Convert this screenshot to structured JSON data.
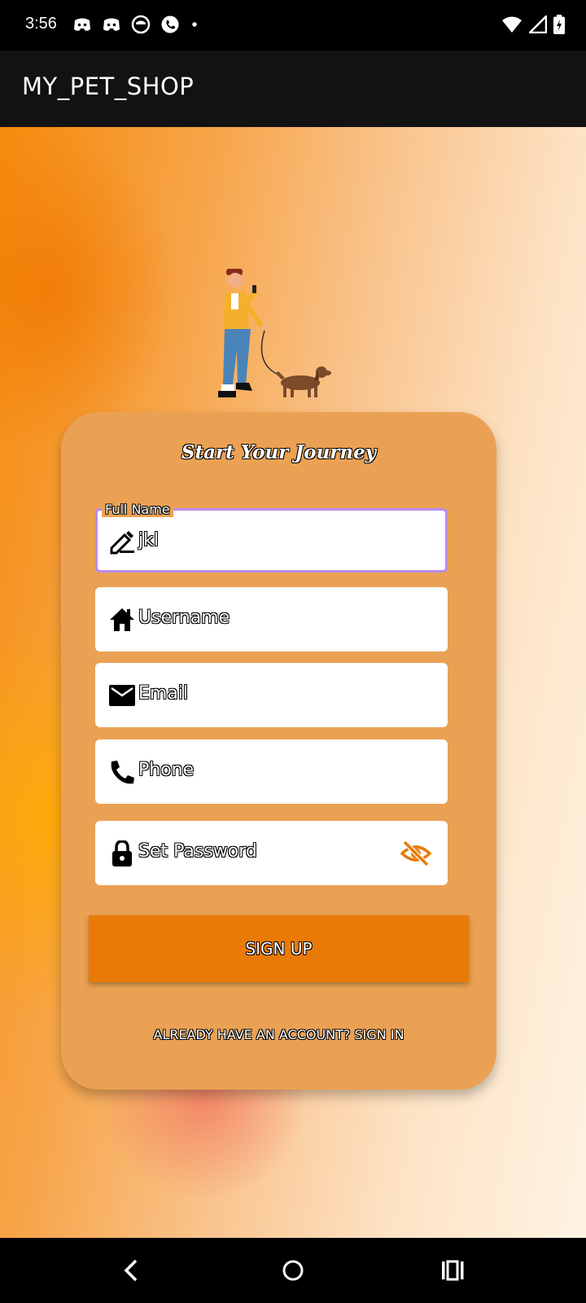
{
  "status_bar": {
    "time": "3:56",
    "notification_icons": [
      "discord-icon",
      "discord-icon",
      "messenger-icon",
      "viber-icon",
      "dot-icon"
    ],
    "system_icons": [
      "wifi-icon",
      "signal-icon",
      "battery-charging-icon"
    ]
  },
  "app_bar": {
    "title": "MY_PET_SHOP"
  },
  "illustration": {
    "icon": "man-walking-dog-illustration"
  },
  "form": {
    "title": "Start Your Journey",
    "full_name": {
      "label": "Full Name",
      "value": "jkl",
      "icon": "pencil-icon"
    },
    "username": {
      "placeholder": "Username",
      "icon": "home-icon"
    },
    "email": {
      "placeholder": "Email",
      "icon": "email-icon"
    },
    "phone": {
      "placeholder": "Phone",
      "icon": "phone-icon"
    },
    "password": {
      "placeholder": "Set Password",
      "icon": "lock-icon",
      "toggle_icon": "eye-off-icon"
    },
    "signup_label": "SIGN UP",
    "signin_link": "ALREADY HAVE AN ACCOUNT? SIGN IN"
  },
  "colors": {
    "card": "#eba153",
    "button": "#ea7a06",
    "accent": "#ea7a06",
    "focus_border": "#b78cf0"
  },
  "nav_bar": {
    "buttons": [
      "back-icon",
      "home-circle-icon",
      "recents-icon"
    ]
  }
}
